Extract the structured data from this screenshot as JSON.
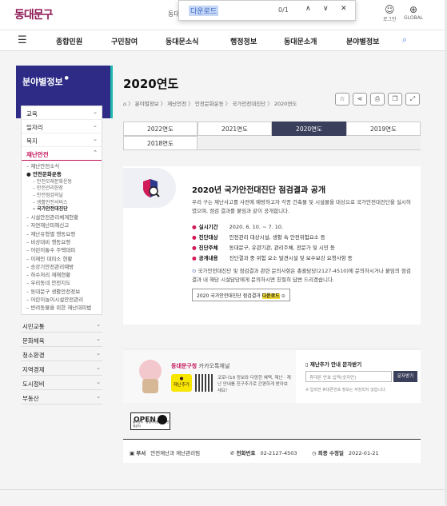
{
  "header": {
    "logo": "동대문구",
    "top_small": "동대",
    "find": {
      "query": "다운로드",
      "count": "0/1",
      "up": "∧",
      "down": "∨",
      "close": "✕"
    },
    "login": "로그인",
    "global": "GLOBAL"
  },
  "gnb": [
    "종합민원",
    "구민참여",
    "동대문소식",
    "행정정보",
    "동대문소개",
    "분야별정보"
  ],
  "lnb": {
    "title": "분야별정보",
    "items": [
      "교육",
      "일자리",
      "복지",
      "재난안전"
    ],
    "sub": [
      "재난안전소식",
      "안전문화운동"
    ],
    "subsub": [
      "안전모래문화운동",
      "안전관리헌장",
      "안전점검의날",
      "생활안전서비스",
      "국가안전대진단"
    ],
    "more": [
      "시설안전관리체계현황",
      "자연재난피해신고",
      "재난유형별 행동요령",
      "비상대비 행동요령",
      "어린이통수 주택대피",
      "이재민 대피소 현황",
      "승강기안전관리예방",
      "하수처리 재해현황",
      "우리동네 안전지도",
      "동대문구 생활안전정보",
      "어린이놀이시설안전관리",
      "반려동물을 위한 재난대피법"
    ],
    "groups": [
      "시민교통",
      "문화체육",
      "청소환경",
      "지역경제",
      "도시정비",
      "부동산"
    ]
  },
  "page": {
    "title": "2020연도",
    "breadcrumb": "⌂  〉 분야별정보 〉 재난안전 〉 안전문화운동 〉 국가안전대진단 〉 2020연도"
  },
  "tabs": [
    "2022연도",
    "2021연도",
    "2020연도",
    "2019연도",
    "2018연도"
  ],
  "content": {
    "title": "2020년 국가안전대진단 점검결과 공개",
    "desc": "우리 구는 재난사고를 사전에 예방하고자 각종 건축물 및 시설물을 대상으로 국가안전대진단을 실시하였으며, 점검 결과를 붙임과 같이 공개합니다.",
    "items": [
      {
        "k": "실시기간",
        "v": "2020. 6. 10. ~ 7. 10."
      },
      {
        "k": "진단대상",
        "v": "안전관리 대상시설, 생활 속 안전위험요소 등"
      },
      {
        "k": "진단주체",
        "v": "동대문구, 유관기관, 관리주체, 전문가 및 시민 등"
      },
      {
        "k": "공개내용",
        "v": "진단결과 중 위험 요소 발견시설 및 보수보강 요청사항 등"
      }
    ],
    "note": "국가안전대진단 및 점검결과 관련 문의사항은 총괄담당(2127-4510)에 문의하시거나 붙임의 점검결과 내 해당 시설담당에게 문의하시면 친절히 답변 드리겠습니다.",
    "download": "2020 국가안전대진단 점검결과",
    "download_hl": "다운로드"
  },
  "kakao": {
    "title": "동대문구청",
    "title_tail": "카카오톡채널",
    "yellow": "재난추가",
    "desc": "코로나19 정보와 다양한 혜택, 재난 · 재난 안내를 친구추가로 간편하게 받아보세요!",
    "sms_title": "재난추가 안내 문자받기",
    "sms_ph": "휴대폰 번호 입력(숫자만)",
    "sms_btn": "문자받기",
    "sms_note": "※ 입력한 휴대폰번호 정보는 저장되지 않습니다."
  },
  "open": {
    "label": "OPEN",
    "small": "출처표시 · 상업적이용금지 · 변경금지"
  },
  "footer": {
    "dept_k": "부서",
    "dept_v": "안전재난과 재난관리팀",
    "tel_k": "전화번호",
    "tel_v": "02-2127-4503",
    "date_k": "최종 수정일",
    "date_v": "2022-01-21"
  }
}
